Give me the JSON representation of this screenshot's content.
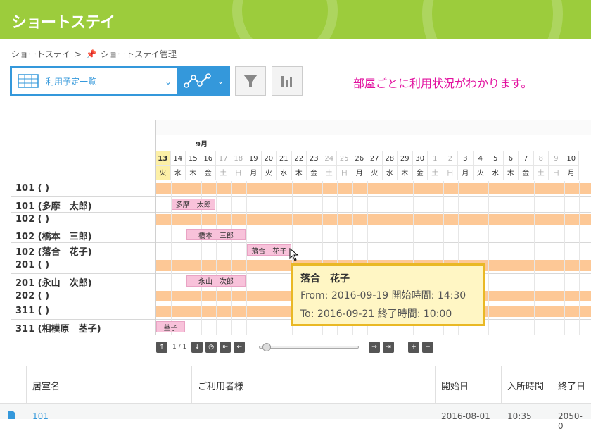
{
  "app_title": "ショートステイ",
  "breadcrumb": {
    "root": "ショートステイ",
    "sep": ">",
    "current": "ショートステイ管理"
  },
  "view": {
    "name": "利用予定一覧"
  },
  "note": "部屋ごとに利用状況がわかります。",
  "calendar": {
    "month": "9月",
    "days": [
      "13",
      "14",
      "15",
      "16",
      "17",
      "18",
      "19",
      "20",
      "21",
      "22",
      "23",
      "24",
      "25",
      "26",
      "27",
      "28",
      "29",
      "30",
      "1",
      "2",
      "3",
      "4",
      "5",
      "6",
      "7",
      "8",
      "9",
      "10"
    ],
    "weekdays": [
      "火",
      "水",
      "木",
      "金",
      "土",
      "日",
      "月",
      "火",
      "水",
      "木",
      "金",
      "土",
      "日",
      "月",
      "火",
      "水",
      "木",
      "金",
      "土",
      "日",
      "月",
      "火",
      "水",
      "木",
      "金",
      "土",
      "日",
      "月"
    ],
    "rows": [
      "101 ( )",
      "101 (多摩　太郎)",
      "102 ( )",
      "102 (橋本　三郎)",
      "102 (落合　花子)",
      "201 ( )",
      "201 (永山　次郎)",
      "202 ( )",
      "311 ( )",
      "311 (相模原　茎子)"
    ],
    "events": [
      "多摩　太郎",
      "橋本　三郎",
      "落合　花子",
      "永山　次郎",
      "茎子"
    ]
  },
  "tooltip": {
    "title": "落合　花子",
    "line1": "From: 2016-09-19 開始時間: 14:30",
    "line2": "To: 2016-09-21 終了時間: 10:00"
  },
  "pager": "1 / 1",
  "table": {
    "headers": [
      "居室名",
      "ご利用者様",
      "開始日",
      "入所時間",
      "終了日"
    ],
    "row": [
      "101",
      "",
      "2016-08-01",
      "10:35",
      "2050-0"
    ]
  },
  "colors": {
    "header": "#9ccc3c",
    "accent": "#3498db",
    "note": "#e2119f",
    "bar": "#fdc896",
    "event": "#f8c2da"
  }
}
